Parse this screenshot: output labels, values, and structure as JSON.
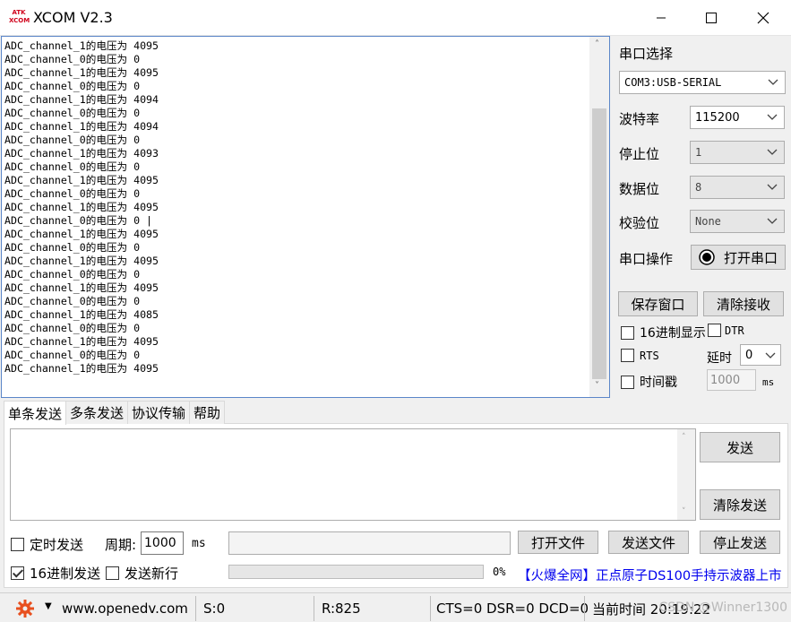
{
  "window": {
    "title": "XCOM V2.3",
    "logo_text": "ATK XCOM"
  },
  "receive": {
    "lines": [
      "ADC_channel_1的电压为 4095",
      "ADC_channel_0的电压为 0",
      "ADC_channel_1的电压为 4095",
      "ADC_channel_0的电压为 0",
      "ADC_channel_1的电压为 4094",
      "ADC_channel_0的电压为 0",
      "ADC_channel_1的电压为 4094",
      "ADC_channel_0的电压为 0",
      "ADC_channel_1的电压为 4093",
      "ADC_channel_0的电压为 0",
      "ADC_channel_1的电压为 4095",
      "ADC_channel_0的电压为 0",
      "ADC_channel_1的电压为 4095",
      "ADC_channel_0的电压为 0 |",
      "ADC_channel_1的电压为 4095",
      "ADC_channel_0的电压为 0",
      "ADC_channel_1的电压为 4095",
      "ADC_channel_0的电压为 0",
      "ADC_channel_1的电压为 4095",
      "ADC_channel_0的电压为 0",
      "ADC_channel_1的电压为 4085",
      "ADC_channel_0的电压为 0",
      "ADC_channel_1的电压为 4095",
      "ADC_channel_0的电压为 0",
      "ADC_channel_1的电压为 4095"
    ]
  },
  "serial": {
    "port_label": "串口选择",
    "port_value": "COM3:USB-SERIAL",
    "baud_label": "波特率",
    "baud_value": "115200",
    "stop_label": "停止位",
    "stop_value": "1",
    "data_label": "数据位",
    "data_value": "8",
    "parity_label": "校验位",
    "parity_value": "None",
    "op_label": "串口操作",
    "open_button": "打开串口",
    "save_button": "保存窗口",
    "clear_recv_button": "清除接收",
    "hex_display": "16进制显示",
    "dtr": "DTR",
    "rts": "RTS",
    "delay_label": "延时",
    "delay_value": "0",
    "timestamp": "时间戳",
    "timestamp_value": "1000",
    "timestamp_unit": "ms"
  },
  "tabs": [
    "单条发送",
    "多条发送",
    "协议传输",
    "帮助"
  ],
  "send": {
    "send_button": "发送",
    "clear_send_button": "清除发送",
    "timed_send": "定时发送",
    "period_label": "周期:",
    "period_value": "1000",
    "period_unit": "ms",
    "open_file_button": "打开文件",
    "send_file_button": "发送文件",
    "stop_send_button": "停止发送",
    "hex_send": "16进制发送",
    "send_newline": "发送新行",
    "progress_percent": "0%",
    "progress_value": 0,
    "promo_text": "【火爆全网】正点原子DS100手持示波器上市"
  },
  "status": {
    "url": "www.openedv.com",
    "sent": "S:0",
    "received": "R:825",
    "signals": "CTS=0 DSR=0 DCD=0",
    "time_label": "当前时间 20:19:22",
    "watermark": "CSDN @Winner1300"
  },
  "colors": {
    "accent": "#0078d7",
    "scroll_border": "#5b86c8",
    "gear": "#e8501f",
    "promo": "#0000ee"
  }
}
